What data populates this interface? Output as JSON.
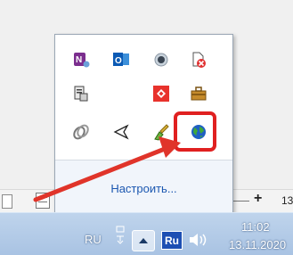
{
  "tray_popup": {
    "icons": [
      {
        "name": "onenote-icon",
        "row": 0,
        "col": 0
      },
      {
        "name": "outlook-icon",
        "row": 0,
        "col": 1
      },
      {
        "name": "record-icon",
        "row": 0,
        "col": 2
      },
      {
        "name": "network-error-icon",
        "row": 0,
        "col": 3
      },
      {
        "name": "printer-icon",
        "row": 1,
        "col": 0
      },
      {
        "name": "anydesk-icon",
        "row": 1,
        "col": 2
      },
      {
        "name": "toolbox-icon",
        "row": 1,
        "col": 3
      },
      {
        "name": "link-icon",
        "row": 2,
        "col": 0
      },
      {
        "name": "flag-icon",
        "row": 2,
        "col": 1
      },
      {
        "name": "brush-icon",
        "row": 2,
        "col": 2
      },
      {
        "name": "globe-icon",
        "row": 2,
        "col": 3
      }
    ],
    "customize_label": "Настроить..."
  },
  "status_bar": {
    "zoom_plus": "+",
    "zoom_value": "13"
  },
  "taskbar": {
    "language": "RU",
    "language_badge": "Ru",
    "time": "11:02",
    "date": "13.11.2020"
  },
  "colors": {
    "highlight": "#e02020",
    "arrow": "#e0342a",
    "link": "#1b57b0"
  }
}
